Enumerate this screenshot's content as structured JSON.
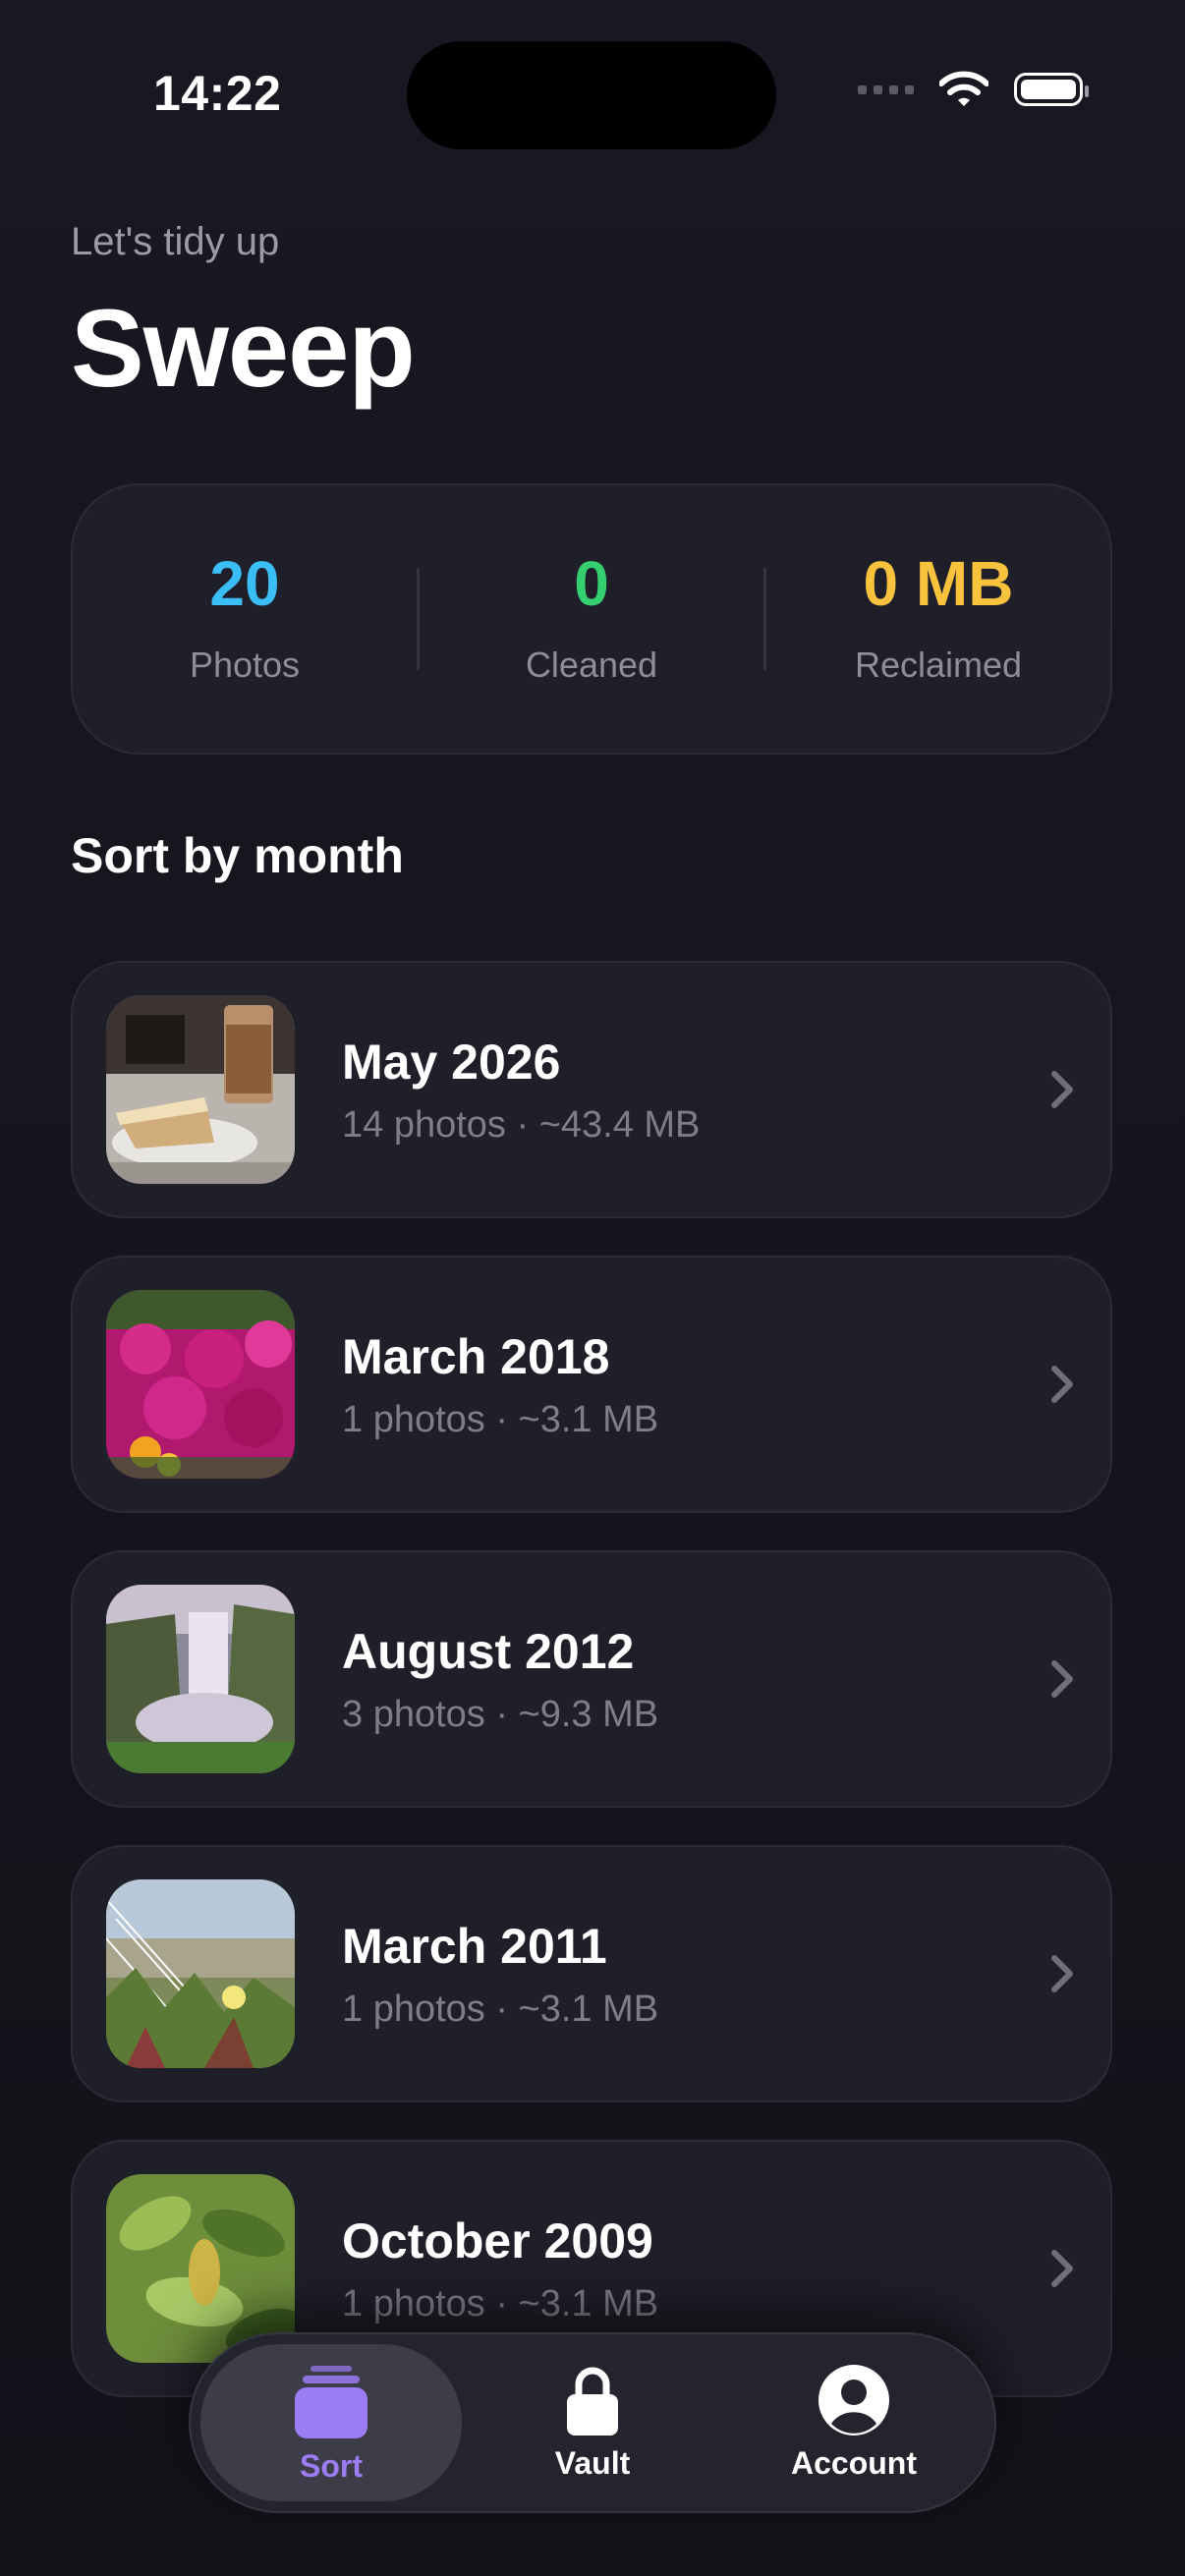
{
  "status_bar": {
    "time": "14:22"
  },
  "header": {
    "subtitle": "Let's tidy up",
    "title": "Sweep"
  },
  "stats": [
    {
      "value": "20",
      "label": "Photos",
      "color": "#3bbdf5"
    },
    {
      "value": "0",
      "label": "Cleaned",
      "color": "#34cf6e"
    },
    {
      "value": "0 MB",
      "label": "Reclaimed",
      "color": "#f8c23d"
    }
  ],
  "section_title": "Sort by month",
  "months": [
    {
      "name": "May 2026",
      "meta": "14 photos · ~43.4 MB",
      "thumbnail": "cake-and-iced-coffee"
    },
    {
      "name": "March 2018",
      "meta": "1 photos · ~3.1 MB",
      "thumbnail": "pink-flowers"
    },
    {
      "name": "August 2012",
      "meta": "3 photos · ~9.3 MB",
      "thumbnail": "waterfall"
    },
    {
      "name": "March 2011",
      "meta": "1 photos · ~3.1 MB",
      "thumbnail": "dune-grass"
    },
    {
      "name": "October 2009",
      "meta": "1 photos · ~3.1 MB",
      "thumbnail": "green-leaves"
    }
  ],
  "tabs": [
    {
      "label": "Sort",
      "icon": "stack-icon",
      "active": true
    },
    {
      "label": "Vault",
      "icon": "lock-icon",
      "active": false
    },
    {
      "label": "Account",
      "icon": "account-icon",
      "active": false
    }
  ],
  "colors": {
    "accent": "#9b7cf2",
    "background": "#14141b",
    "card": "#1f1f2a"
  }
}
